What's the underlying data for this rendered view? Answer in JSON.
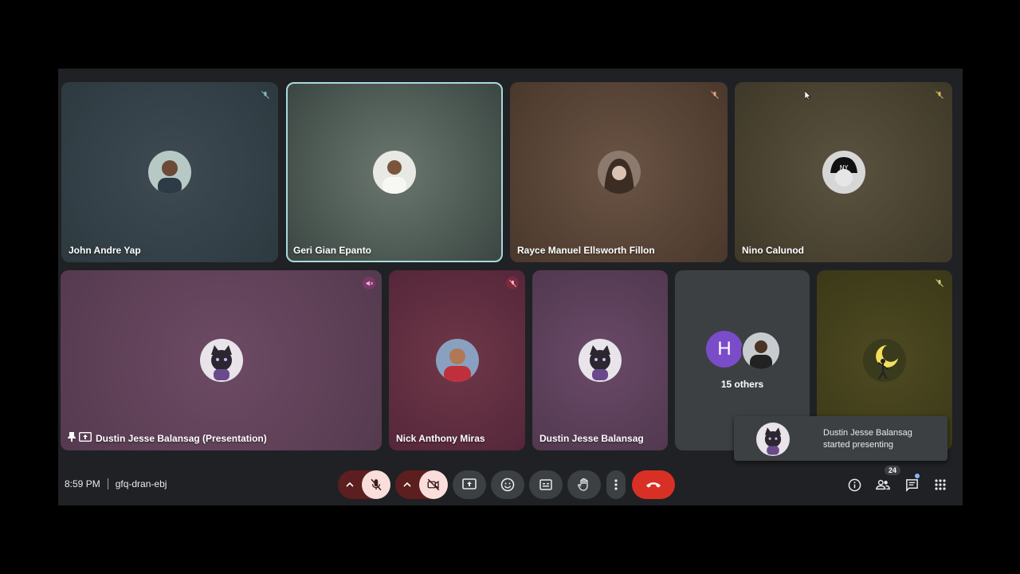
{
  "participants_top": [
    {
      "name": "John Andre Yap"
    },
    {
      "name": "Geri Gian Epanto"
    },
    {
      "name": "Rayce Manuel Ellsworth Fillon"
    },
    {
      "name": "Nino Calunod"
    }
  ],
  "participants_bottom": [
    {
      "name": "Dustin Jesse Balansag (Presentation)"
    },
    {
      "name": "Nick Anthony Miras"
    },
    {
      "name": "Dustin Jesse Balansag"
    }
  ],
  "others": {
    "initial": "H",
    "label": "15 others"
  },
  "toast": {
    "line1": "Dustin Jesse Balansag",
    "line2": "started presenting"
  },
  "meeting": {
    "time": "8:59 PM",
    "code": "gfq-dran-ebj"
  },
  "people_count": "24",
  "colors": {
    "end_call": "#d93025",
    "active_speaker_border": "#a8dadc",
    "mic_off_bg": "#f9dedc",
    "others_avatar": "#7b4cc9"
  },
  "icons": {
    "mic": "mic-off-icon",
    "camera": "camera-off-icon",
    "present": "present-screen-icon",
    "emoji": "emoji-icon",
    "captions": "captions-icon",
    "hand": "raise-hand-icon",
    "more": "more-options-icon",
    "end": "end-call-icon",
    "info": "info-icon",
    "people": "people-icon",
    "chat": "chat-icon",
    "activities": "activities-icon"
  }
}
